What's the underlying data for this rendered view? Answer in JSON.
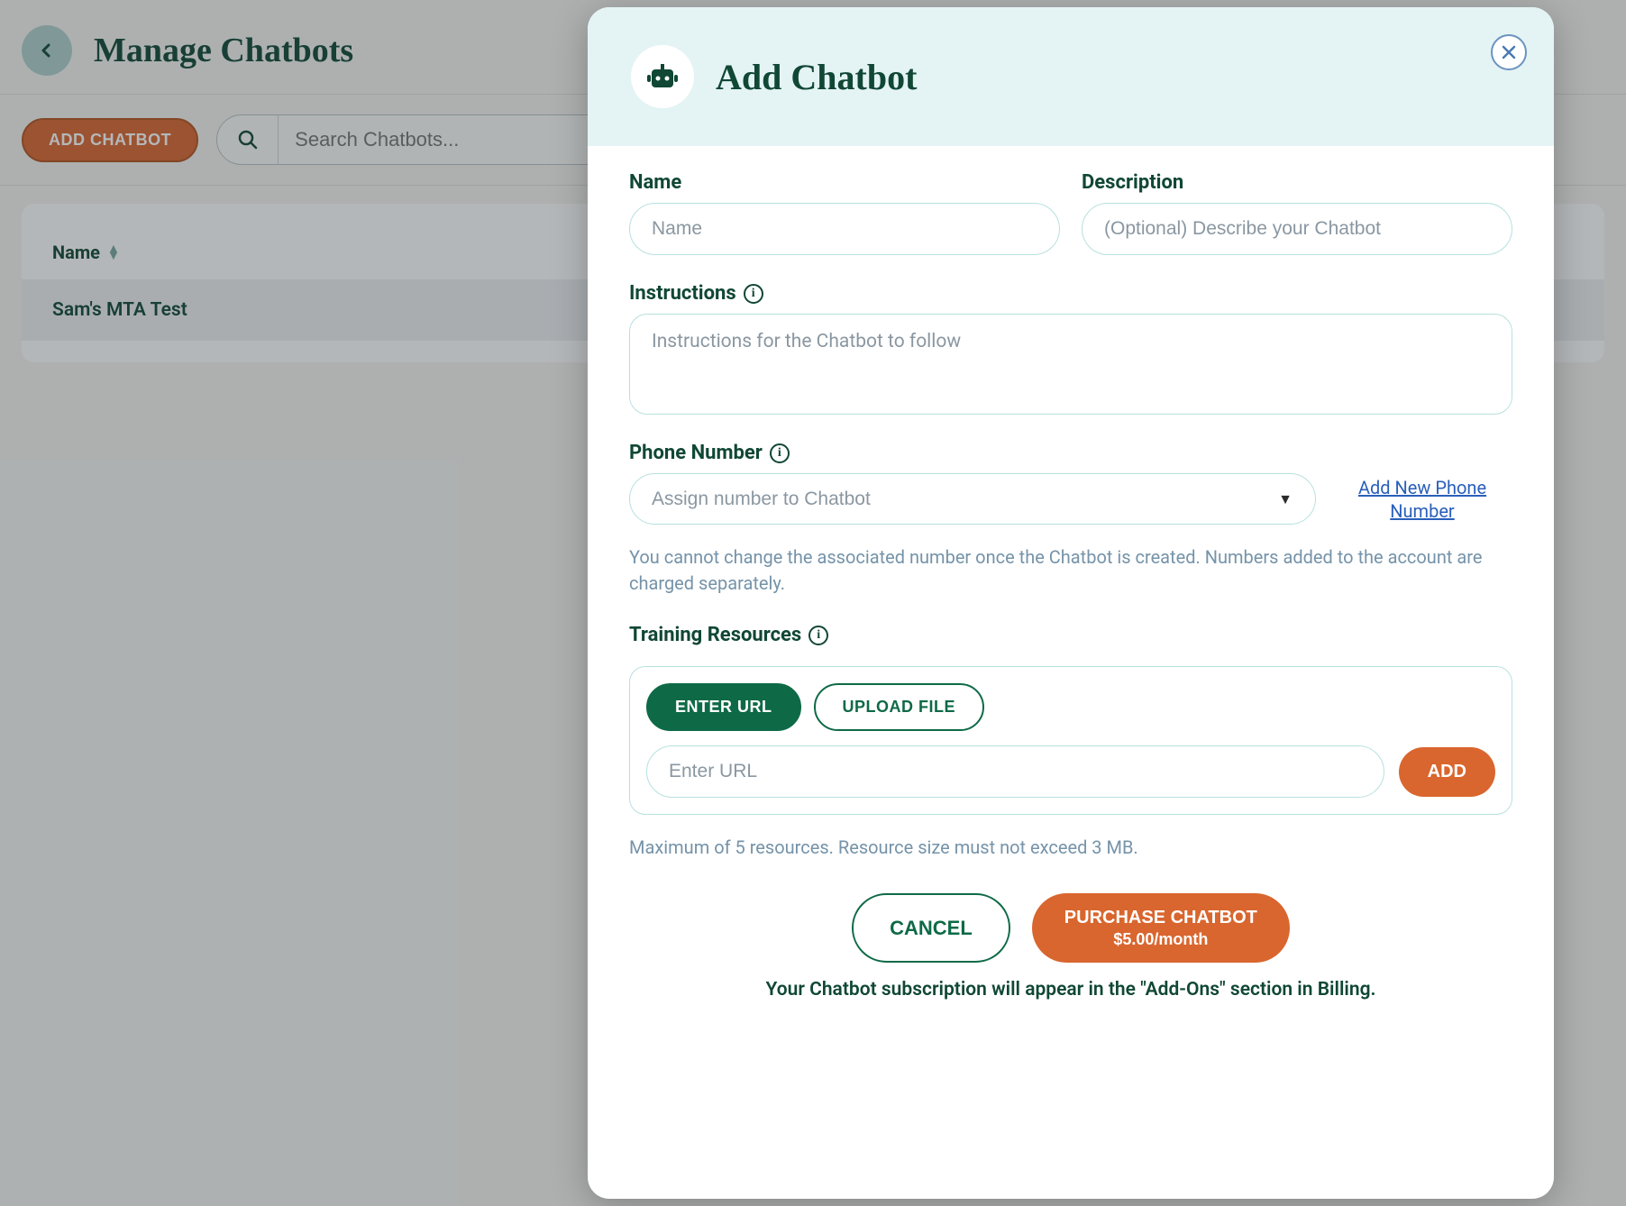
{
  "page": {
    "title": "Manage Chatbots",
    "add_button": "ADD CHATBOT",
    "search_placeholder": "Search Chatbots..."
  },
  "table": {
    "columns": {
      "name": "Name"
    },
    "rows": [
      {
        "name": "Sam's MTA Test"
      }
    ]
  },
  "modal": {
    "title": "Add Chatbot",
    "fields": {
      "name": {
        "label": "Name",
        "placeholder": "Name"
      },
      "description": {
        "label": "Description",
        "placeholder": "(Optional) Describe your Chatbot"
      },
      "instructions": {
        "label": "Instructions",
        "placeholder": "Instructions for the Chatbot to follow"
      },
      "phone": {
        "label": "Phone Number",
        "placeholder": "Assign number to Chatbot",
        "add_link": "Add New Phone Number",
        "help": "You cannot change the associated number once the Chatbot is created. Numbers added to the account are charged separately."
      },
      "training": {
        "label": "Training Resources",
        "tab_url": "ENTER URL",
        "tab_file": "UPLOAD FILE",
        "url_placeholder": "Enter URL",
        "add_btn": "ADD",
        "help": "Maximum of 5 resources. Resource size must not exceed 3 MB."
      }
    },
    "actions": {
      "cancel": "CANCEL",
      "purchase": "PURCHASE CHATBOT",
      "purchase_price": "$5.00/month"
    },
    "billing_note": "Your Chatbot subscription will appear in the \"Add-Ons\" section in Billing."
  }
}
